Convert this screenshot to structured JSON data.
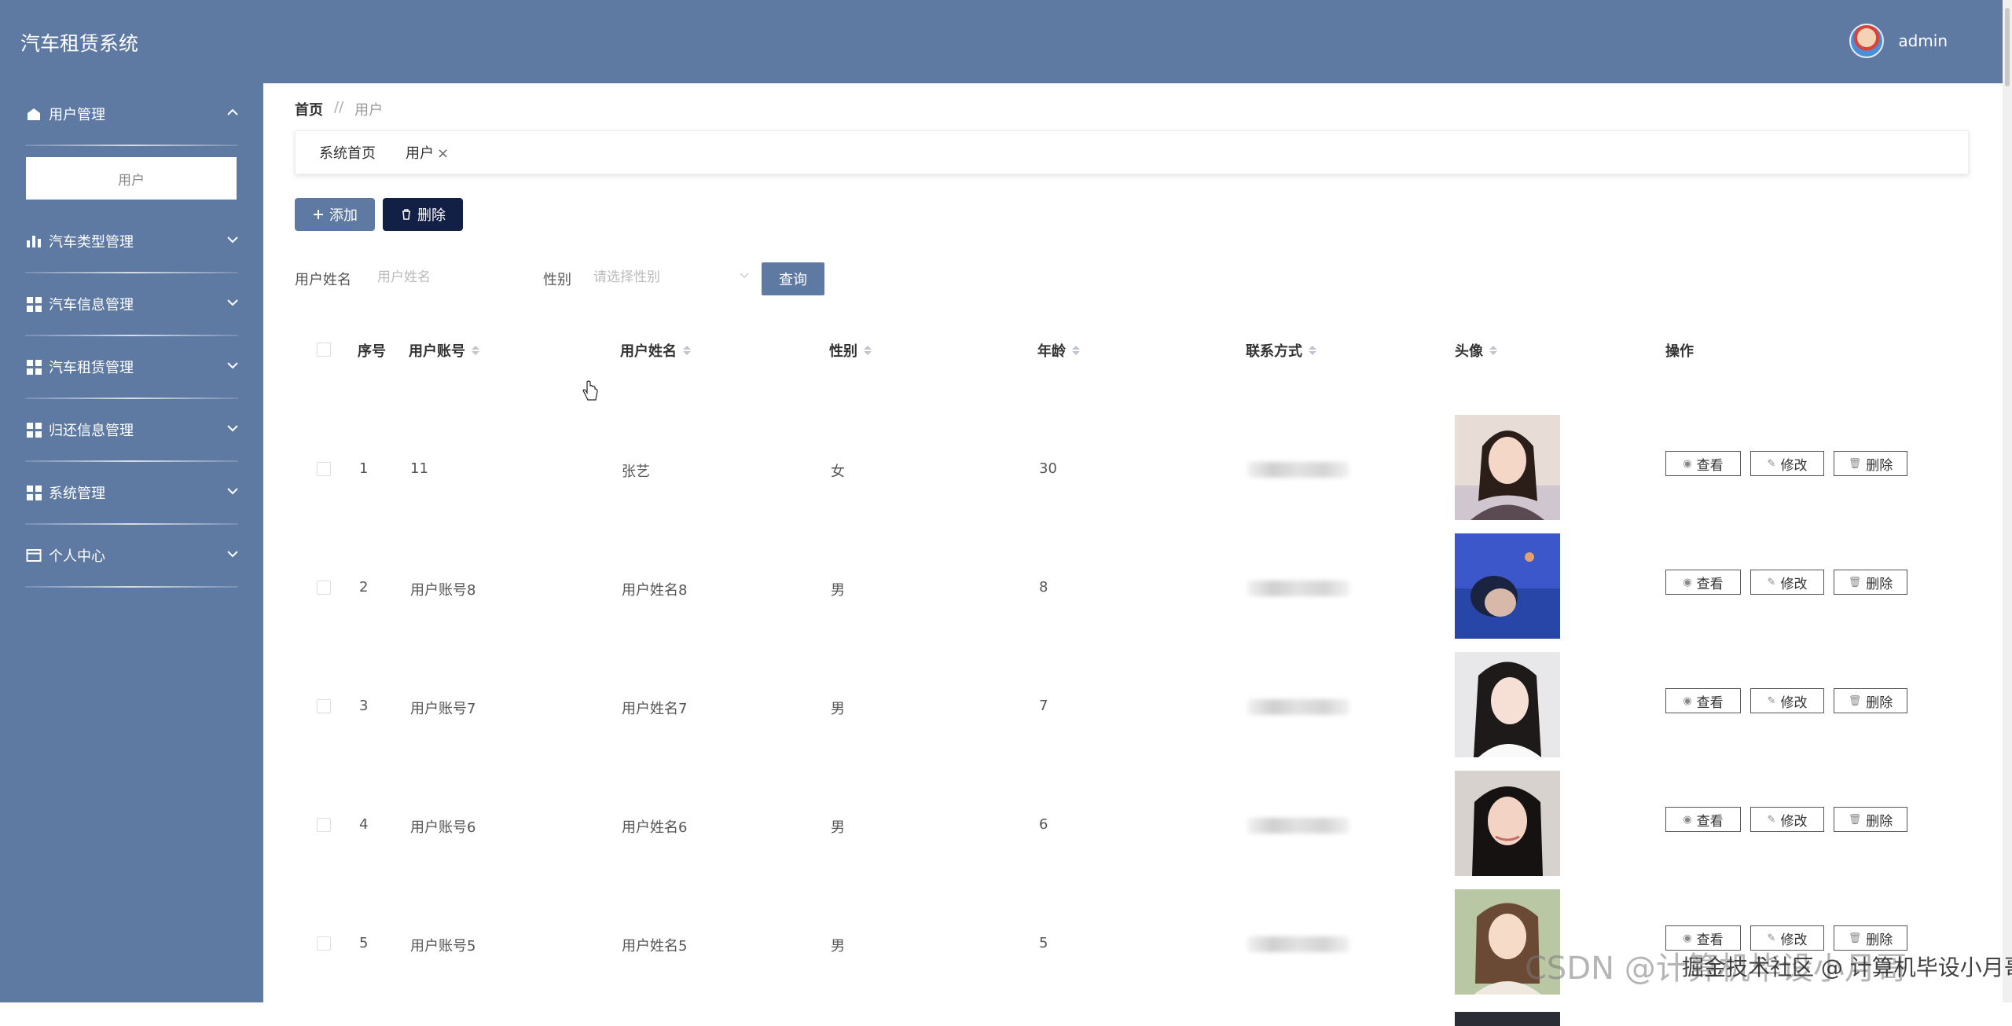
{
  "header": {
    "app_title": "汽车租赁系统",
    "username": "admin"
  },
  "sidebar": {
    "items": [
      {
        "label": "用户管理",
        "icon": "home-icon",
        "expanded": true,
        "children": [
          {
            "label": "用户"
          }
        ]
      },
      {
        "label": "汽车类型管理",
        "icon": "bar-chart-icon"
      },
      {
        "label": "汽车信息管理",
        "icon": "grid-icon"
      },
      {
        "label": "汽车租赁管理",
        "icon": "grid-icon"
      },
      {
        "label": "归还信息管理",
        "icon": "grid-icon"
      },
      {
        "label": "系统管理",
        "icon": "grid-icon"
      },
      {
        "label": "个人中心",
        "icon": "card-icon"
      }
    ]
  },
  "breadcrumb": {
    "home": "首页",
    "separator": "//",
    "current": "用户"
  },
  "tabs": [
    {
      "label": "系统首页"
    },
    {
      "label": "用户",
      "close": "×"
    }
  ],
  "toolbar": {
    "add_label": "添加",
    "delete_label": "删除"
  },
  "filters": {
    "name_label": "用户姓名",
    "name_placeholder": "用户姓名",
    "gender_label": "性别",
    "gender_placeholder": "请选择性别",
    "query_label": "查询"
  },
  "table": {
    "headers": [
      "序号",
      "用户账号",
      "用户姓名",
      "性别",
      "年龄",
      "联系方式",
      "头像",
      "操作"
    ],
    "rows": [
      {
        "index": "1",
        "account": "11",
        "name": "张艺",
        "gender": "女",
        "age": "30"
      },
      {
        "index": "2",
        "account": "用户账号8",
        "name": "用户姓名8",
        "gender": "男",
        "age": "8"
      },
      {
        "index": "3",
        "account": "用户账号7",
        "name": "用户姓名7",
        "gender": "男",
        "age": "7"
      },
      {
        "index": "4",
        "account": "用户账号6",
        "name": "用户姓名6",
        "gender": "男",
        "age": "6"
      },
      {
        "index": "5",
        "account": "用户账号5",
        "name": "用户姓名5",
        "gender": "男",
        "age": "5"
      }
    ],
    "actions": {
      "view": "查看",
      "edit": "修改",
      "delete": "删除"
    }
  },
  "watermark": {
    "main": "CSDN @计算机毕设小月哥",
    "sub": "掘金技术社区 @ 计算机毕设小月哥"
  },
  "colors": {
    "primary": "#5f7aa2",
    "danger_dark": "#132045"
  }
}
